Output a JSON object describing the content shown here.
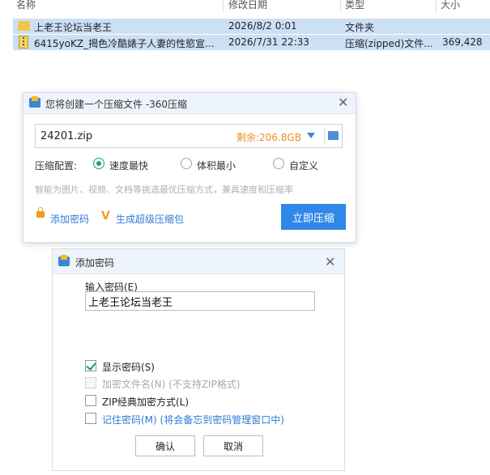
{
  "file_list": {
    "headers": {
      "name": "名称",
      "modified": "修改日期",
      "type": "类型",
      "size": "大小"
    },
    "rows": [
      {
        "name": "上老王论坛当老王",
        "modified": "2026/8/2 0:01",
        "type": "文件夹",
        "size": ""
      },
      {
        "name": "6415yoKZ_揭色冷酷婊子人妻的性慾宣...",
        "modified": "2026/7/31 22:33",
        "type": "压缩(zipped)文件...",
        "size": "369,428"
      }
    ]
  },
  "compress_dialog": {
    "title": "您将创建一个压缩文件 -360压缩",
    "filename": "24201.zip",
    "space_remaining": "剩余:206.8GB",
    "config_label": "压缩配置:",
    "options": [
      "速度最快",
      "体积最小",
      "自定义"
    ],
    "selected_option": "速度最快",
    "hint": "智能为图片、视频、文档等挑选最优压缩方式，兼具速度和压缩率",
    "add_password": "添加密码",
    "super_pack": "生成超级压缩包",
    "compress_button": "立即压缩"
  },
  "password_dialog": {
    "title": "添加密码",
    "input_label": "输入密码(E)",
    "input_value": "上老王论坛当老王",
    "checkboxes": [
      {
        "label": "显示密码(S)",
        "checked": true,
        "enabled": true
      },
      {
        "label": "加密文件名(N) (不支持ZIP格式)",
        "checked": false,
        "enabled": false
      },
      {
        "label": "ZIP经典加密方式(L)",
        "checked": false,
        "enabled": true
      },
      {
        "label": "记住密码(M) (将会备忘到密码管理窗口中)",
        "checked": false,
        "enabled": true
      }
    ],
    "ok_button": "确认",
    "cancel_button": "取消"
  }
}
